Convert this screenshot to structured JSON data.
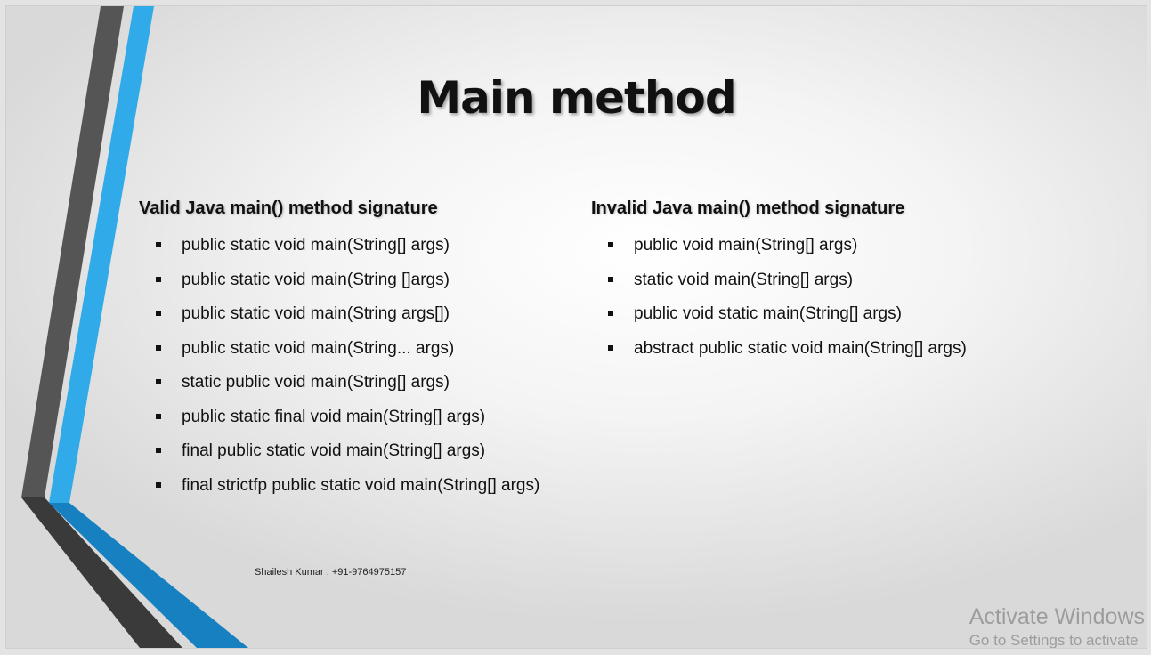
{
  "slide": {
    "title": "Main method",
    "valid": {
      "heading": "Valid Java main() method signature",
      "items": [
        "public static void main(String[] args)",
        "public static void main(String []args)",
        "public static void main(String args[])",
        "public static void main(String... args)",
        "static public void main(String[] args)",
        "public static final void main(String[] args)",
        "final public static void main(String[] args)",
        "final strictfp public static void main(String[] args)"
      ]
    },
    "invalid": {
      "heading": "Invalid Java main() method signature",
      "items": [
        "public void main(String[] args)",
        "static void main(String[] args)",
        "public void static main(String[] args)",
        "abstract public static void main(String[] args)"
      ]
    },
    "footer": "Shailesh Kumar : +91-9764975157"
  },
  "watermark": {
    "title": "Activate Windows",
    "subtitle": "Go to Settings to activate"
  },
  "colors": {
    "stripe_dark": "#555555",
    "stripe_blue": "#30aae8",
    "stripe_deep_blue": "#1780c0",
    "stripe_black": "#3a3a3a"
  }
}
